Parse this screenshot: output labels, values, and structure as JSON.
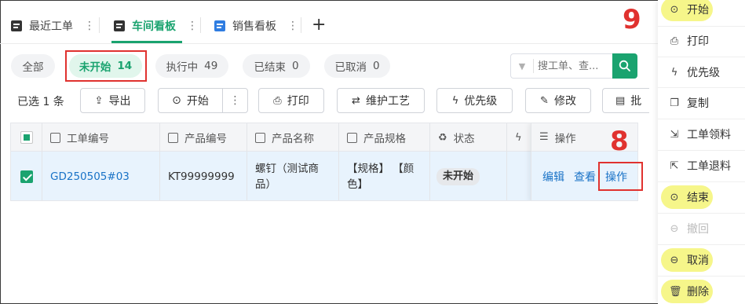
{
  "tabs": [
    {
      "label": "最近工单",
      "icon": "document-icon"
    },
    {
      "label": "车间看板",
      "icon": "document-icon",
      "active": true
    },
    {
      "label": "销售看板",
      "icon": "document-icon"
    }
  ],
  "add_tab_label": "+",
  "filters": [
    {
      "label": "全部",
      "count": ""
    },
    {
      "label": "未开始",
      "count": "14",
      "active": true
    },
    {
      "label": "执行中",
      "count": "49"
    },
    {
      "label": "已结束",
      "count": "0"
    },
    {
      "label": "已取消",
      "count": "0"
    }
  ],
  "search": {
    "placeholder": "搜工单、查..."
  },
  "toolbar": {
    "selected": "已选 1 条",
    "export": "导出",
    "start": "开始",
    "print": "打印",
    "maintain_process": "维护工艺",
    "priority": "优先级",
    "edit": "修改",
    "more_partial": "批"
  },
  "table": {
    "headers": [
      "工单编号",
      "产品编号",
      "产品名称",
      "产品规格",
      "状态",
      "操作"
    ],
    "row": {
      "order_no": "GD250505#03",
      "product_no": "KT99999999",
      "product_name_1": "螺钉（测试商",
      "product_name_2": "品）",
      "spec_1": "【规格】 【颜",
      "spec_2": "色】",
      "status": "未开始",
      "actions": [
        "编辑",
        "查看",
        "操作"
      ]
    }
  },
  "annotations": {
    "step_8": "8",
    "step_9": "9"
  },
  "menu": {
    "items": [
      {
        "label": "开始",
        "icon": "play-circle-icon",
        "highlight": true
      },
      {
        "label": "打印",
        "icon": "printer-icon"
      },
      {
        "label": "优先级",
        "icon": "lightning-icon"
      },
      {
        "label": "复制",
        "icon": "copy-icon"
      },
      {
        "label": "工单领料",
        "icon": "material-in-icon"
      },
      {
        "label": "工单退料",
        "icon": "material-out-icon"
      },
      {
        "label": "结束",
        "icon": "stop-circle-icon",
        "highlight": true
      },
      {
        "label": "撤回",
        "icon": "undo-icon",
        "disabled": true
      },
      {
        "label": "取消",
        "icon": "minus-circle-icon",
        "highlight": true
      },
      {
        "label": "删除",
        "icon": "trash-icon",
        "highlight": true
      }
    ]
  },
  "colors": {
    "brand": "#1aa36f",
    "link": "#1a73c7",
    "annotation_red": "#e0322f",
    "highlight_yellow": "#f6f68a"
  }
}
